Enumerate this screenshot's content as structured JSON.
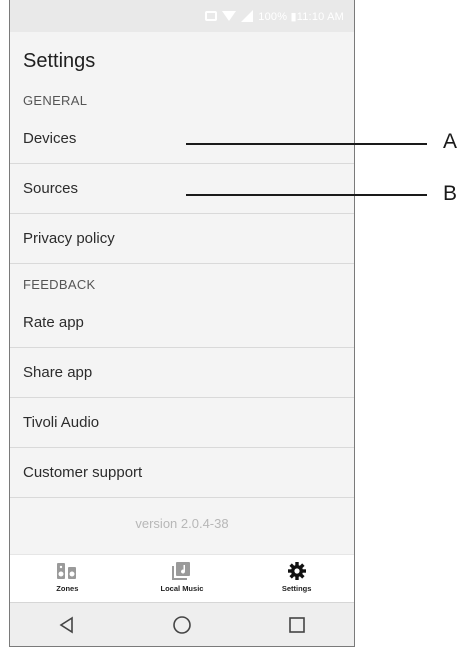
{
  "status_bar": {
    "text": "100% ▮11:10 AM"
  },
  "header": {
    "title": "Settings"
  },
  "sections": [
    {
      "header": "GENERAL",
      "items": [
        "Devices",
        "Sources",
        "Privacy policy"
      ]
    },
    {
      "header": "FEEDBACK",
      "items": [
        "Rate app",
        "Share app",
        "Tivoli Audio",
        "Customer support"
      ]
    }
  ],
  "version": "version 2.0.4-38",
  "bottom_nav": {
    "tabs": [
      {
        "label": "Zones",
        "icon": "speakers-icon"
      },
      {
        "label": "Local Music",
        "icon": "music-library-icon"
      },
      {
        "label": "Settings",
        "icon": "gear-icon",
        "active": true
      }
    ]
  },
  "system_nav": [
    "back-icon",
    "home-icon",
    "recents-icon"
  ],
  "callouts": [
    {
      "label": "A",
      "target": "Devices"
    },
    {
      "label": "B",
      "target": "Sources"
    }
  ],
  "colors": {
    "background": "#f4f4f4",
    "status_bar": "#e9e9e9",
    "divider": "#d9d9d9",
    "version_text": "#b7b7b7"
  }
}
